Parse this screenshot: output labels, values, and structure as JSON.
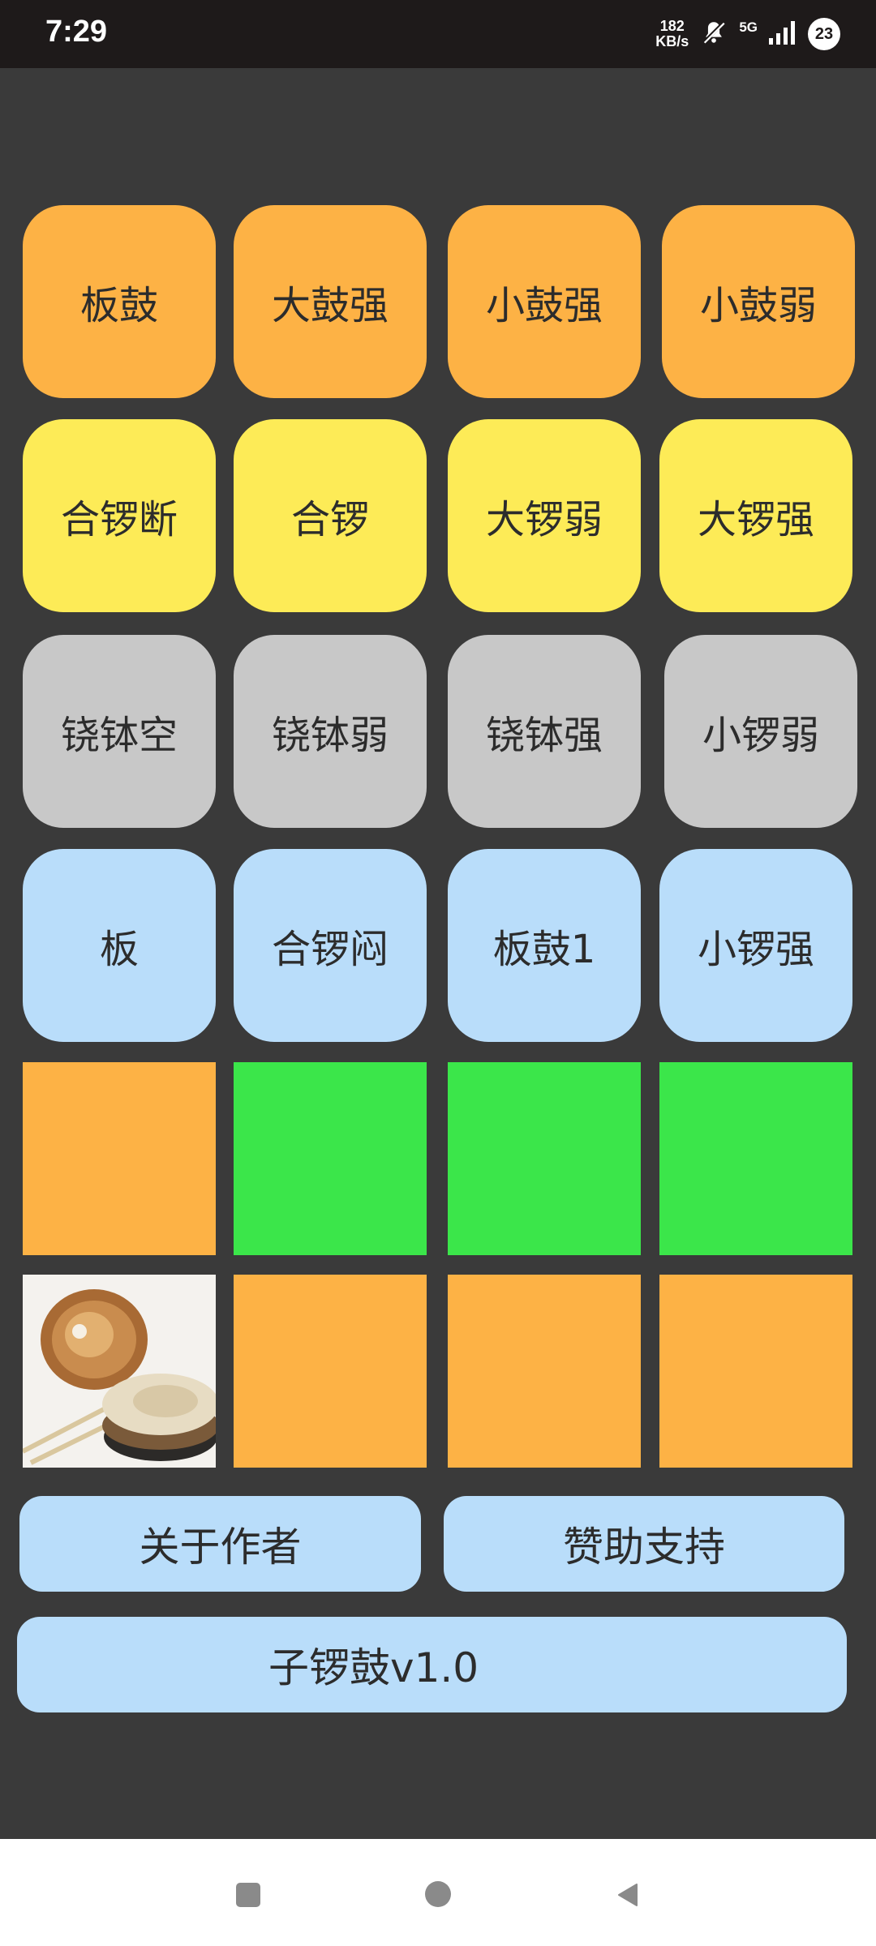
{
  "status_bar": {
    "time": "7:29",
    "net_speed_value": "182",
    "net_speed_unit": "KB/s",
    "network": "5G",
    "notification_count": "23",
    "icons": [
      "mute-bell-icon",
      "signal-icon"
    ]
  },
  "pads": {
    "row1": [
      "板鼓",
      "大鼓强",
      "小鼓强",
      "小鼓弱"
    ],
    "row2": [
      "合锣断",
      "合锣",
      "大锣弱",
      "大锣强"
    ],
    "row3": [
      "铙钵空",
      "铙钵弱",
      "铙钵强",
      "小锣弱"
    ],
    "row4": [
      "板",
      "合锣闷",
      "板鼓1",
      "小锣强"
    ]
  },
  "colors": {
    "orange": "#fdb245",
    "yellow": "#fdeb57",
    "gray": "#c8c8c8",
    "blue": "#b9ddfa",
    "green": "#3be64a",
    "background": "#3a3a3a"
  },
  "buttons": {
    "about": "关于作者",
    "support": "赞助支持",
    "version": "子锣鼓v1.0"
  },
  "image": {
    "icon": "drum-photo-icon"
  },
  "nav_bar": {
    "icons": [
      "recents-icon",
      "home-icon",
      "back-icon"
    ]
  }
}
